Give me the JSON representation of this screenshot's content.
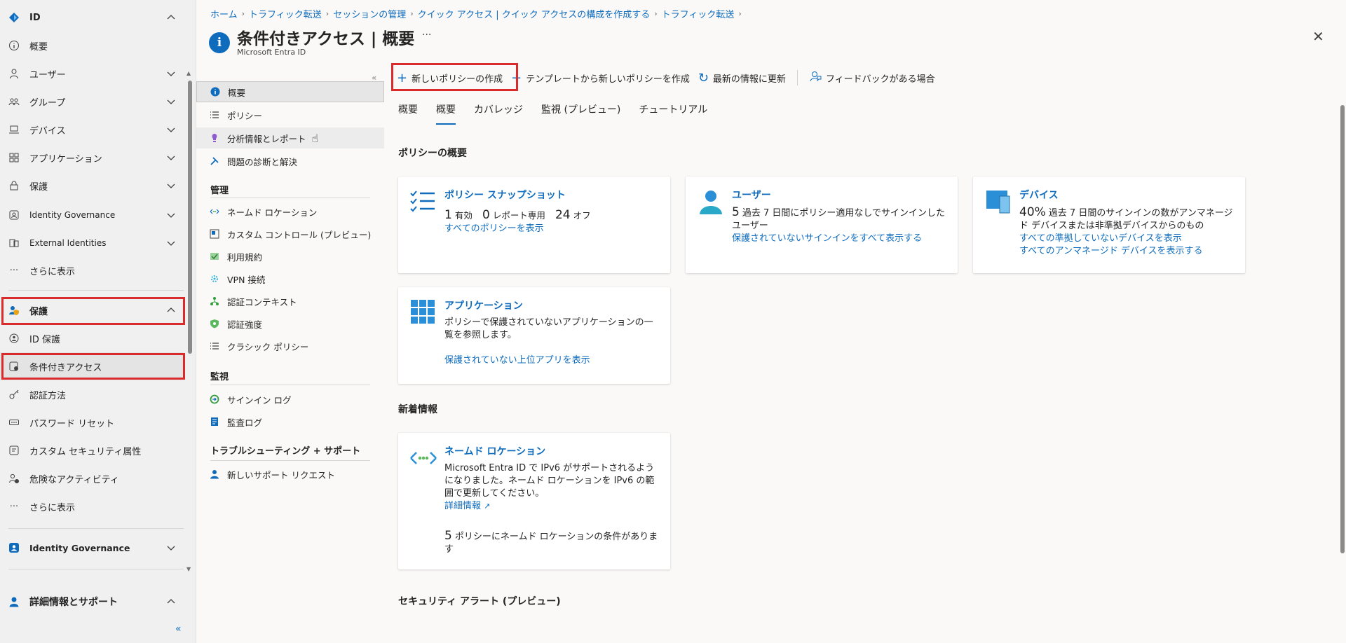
{
  "leftnav": {
    "items": [
      {
        "label": "ID",
        "icon": "diamond-icon",
        "bold": true,
        "chevron": "up"
      },
      {
        "label": "概要",
        "icon": "info-icon",
        "chevron": ""
      },
      {
        "label": "ユーザー",
        "icon": "person-icon",
        "chevron": "down"
      },
      {
        "label": "グループ",
        "icon": "people-icon",
        "chevron": "down"
      },
      {
        "label": "デバイス",
        "icon": "laptop-icon",
        "chevron": "down"
      },
      {
        "label": "アプリケーション",
        "icon": "apps-icon",
        "chevron": "down"
      },
      {
        "label": "保護",
        "icon": "lock-icon",
        "chevron": "down"
      },
      {
        "label": "Identity Governance",
        "icon": "governance-icon",
        "chevron": "down"
      },
      {
        "label": "External Identities",
        "icon": "external-icon",
        "chevron": "down"
      },
      {
        "label": "さらに表示",
        "icon": "more-icon",
        "chevron": ""
      }
    ],
    "protection": {
      "label": "保護",
      "icon": "protection-icon"
    },
    "protection_items": [
      {
        "label": "ID 保護",
        "icon": "id-protection-icon"
      },
      {
        "label": "条件付きアクセス",
        "icon": "conditional-access-icon"
      },
      {
        "label": "認証方法",
        "icon": "key-icon"
      },
      {
        "label": "パスワード リセット",
        "icon": "password-icon"
      },
      {
        "label": "カスタム セキュリティ属性",
        "icon": "attribute-icon"
      },
      {
        "label": "危険なアクティビティ",
        "icon": "risky-icon"
      },
      {
        "label": "さらに表示",
        "icon": "more-icon"
      }
    ],
    "identity_governance": {
      "label": "Identity Governance",
      "icon": "governance-icon"
    },
    "support": {
      "label": "詳細情報とサポート",
      "icon": "support-icon"
    }
  },
  "breadcrumb": [
    "ホーム",
    "トラフィック転送",
    "セッションの管理",
    "クイック アクセス | クイック アクセスの構成を作成する",
    "トラフィック転送"
  ],
  "page": {
    "title": "条件付きアクセス | 概要",
    "subtitle": "Microsoft Entra ID",
    "more": "···",
    "close": "✕"
  },
  "resmenu": {
    "top_items": [
      {
        "label": "概要",
        "icon": "info-icon"
      },
      {
        "label": "ポリシー",
        "icon": "list-icon"
      },
      {
        "label": "分析情報とレポート",
        "icon": "bulb-icon"
      },
      {
        "label": "問題の診断と解決",
        "icon": "wrench-icon"
      }
    ],
    "manage_title": "管理",
    "manage_items": [
      {
        "label": "ネームド ロケーション",
        "icon": "location-icon"
      },
      {
        "label": "カスタム コントロール (プレビュー)",
        "icon": "control-icon"
      },
      {
        "label": "利用規約",
        "icon": "terms-icon"
      },
      {
        "label": "VPN 接続",
        "icon": "vpn-icon"
      },
      {
        "label": "認証コンテキスト",
        "icon": "context-icon"
      },
      {
        "label": "認証強度",
        "icon": "strength-icon"
      },
      {
        "label": "クラシック ポリシー",
        "icon": "classic-icon"
      }
    ],
    "monitor_title": "監視",
    "monitor_items": [
      {
        "label": "サインイン ログ",
        "icon": "signin-icon"
      },
      {
        "label": "監査ログ",
        "icon": "audit-icon"
      }
    ],
    "support_title": "トラブルシューティング + サポート",
    "support_items": [
      {
        "label": "新しいサポート リクエスト",
        "icon": "support-request-icon"
      }
    ]
  },
  "toolbar": {
    "new_policy": "新しいポリシーの作成",
    "new_from_template": "テンプレートから新しいポリシーを作成",
    "refresh": "最新の情報に更新",
    "feedback": "フィードバックがある場合"
  },
  "tabs": [
    "概要",
    "概要",
    "カバレッジ",
    "監視 (プレビュー)",
    "チュートリアル"
  ],
  "policy_overview": {
    "title": "ポリシーの概要",
    "snapshot": {
      "title": "ポリシー スナップショット",
      "enabled_count": "1",
      "enabled_label": "有効",
      "report_count": "0",
      "report_label": "レポート専用",
      "off_count": "24",
      "off_label": "オフ",
      "link": "すべてのポリシーを表示"
    },
    "users": {
      "title": "ユーザー",
      "count": "5",
      "text": "過去 7 日間にポリシー適用なしでサインインしたユーザー",
      "link": "保護されていないサインインをすべて表示する"
    },
    "devices": {
      "title": "デバイス",
      "percent": "40%",
      "text": "過去 7 日間のサインインの数がアンマネージド デバイスまたは非準拠デバイスからのもの",
      "link1": "すべての準拠していないデバイスを表示",
      "link2": "すべてのアンマネージド デバイスを表示する"
    },
    "apps": {
      "title": "アプリケーション",
      "text": "ポリシーで保護されていないアプリケーションの一覧を参照します。",
      "link": "保護されていない上位アプリを表示"
    }
  },
  "whats_new": {
    "title": "新着情報",
    "named": {
      "title": "ネームド ロケーション",
      "text": "Microsoft Entra ID で IPv6 がサポートされるようになりました。ネームド ロケーションを IPv6 の範囲で更新してください。",
      "link": "詳細情報",
      "count": "5",
      "count_text": "ポリシーにネームド ロケーションの条件があります"
    }
  },
  "security_alerts": {
    "title": "セキュリティ アラート (プレビュー)"
  },
  "colors": {
    "accent": "#0f6cbd",
    "highlight": "#d92b2b"
  }
}
